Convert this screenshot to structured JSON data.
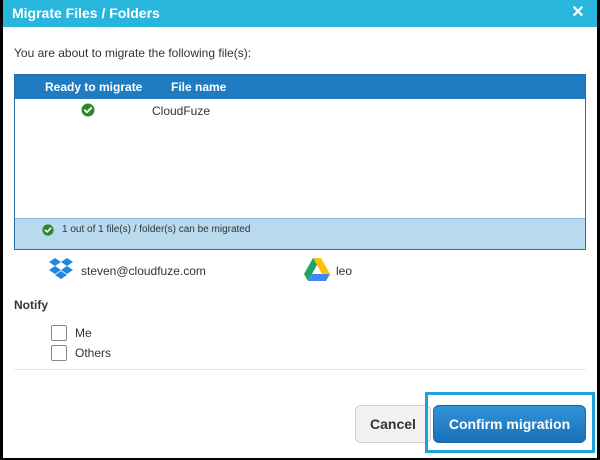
{
  "dialog": {
    "title": "Migrate Files / Folders",
    "close_glyph": "✕",
    "intro": "You are about to migrate the following file(s):"
  },
  "table": {
    "headers": [
      "Ready to migrate",
      "File name"
    ],
    "rows": [
      {
        "status_icon": "check-circle-icon",
        "name": "CloudFuze"
      }
    ],
    "footer": "1 out of 1 file(s) / folder(s) can be migrated"
  },
  "accounts": {
    "source": {
      "icon": "dropbox-icon",
      "label": "steven@cloudfuze.com"
    },
    "destination": {
      "icon": "google-drive-icon",
      "label": "leo"
    }
  },
  "notify": {
    "label": "Notify",
    "options": [
      {
        "label": "Me",
        "checked": false
      },
      {
        "label": "Others",
        "checked": false
      }
    ]
  },
  "buttons": {
    "cancel": "Cancel",
    "confirm": "Confirm migration"
  },
  "colors": {
    "titlebar": "#29b6dc",
    "table_header": "#1f7cc0",
    "table_footer": "#b9d9ee",
    "success": "#2a8a2a",
    "confirm_button": "#1a70b8",
    "highlight_border": "#1fa2dc"
  }
}
